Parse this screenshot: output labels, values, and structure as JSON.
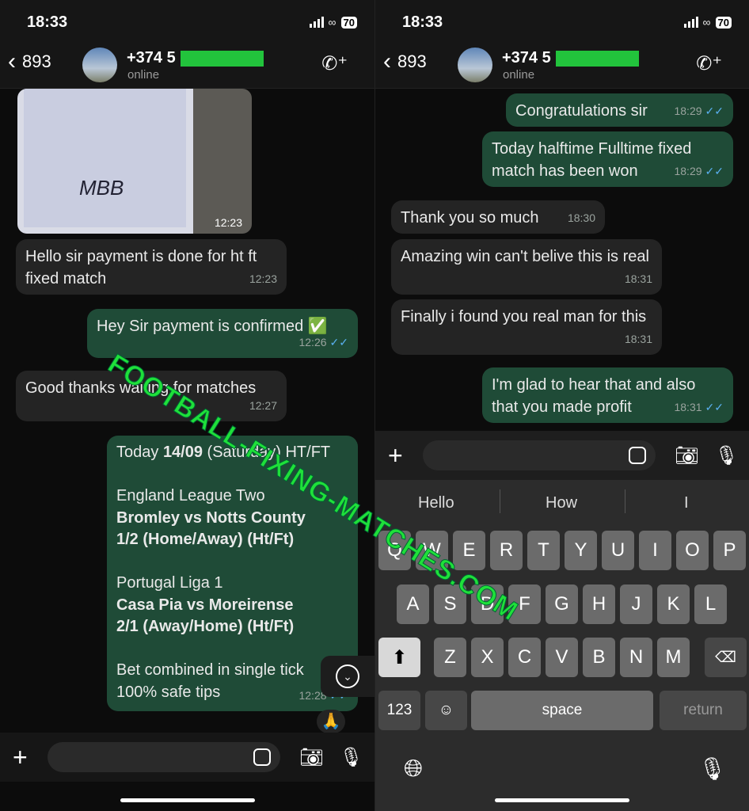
{
  "status": {
    "time": "18:33",
    "battery": "70"
  },
  "header": {
    "back_count": "893",
    "contact": "+374 5",
    "presence": "online"
  },
  "left_messages": [
    {
      "type": "image",
      "time": "12:23",
      "sig": "MBB"
    },
    {
      "dir": "in",
      "text": "Hello sir payment is done for ht ft fixed match",
      "time": "12:23"
    },
    {
      "dir": "out",
      "text": "Hey Sir payment is confirmed ✅",
      "time": "12:26"
    },
    {
      "dir": "in",
      "text": "Good thanks waiting for matches",
      "time": "12:27"
    },
    {
      "dir": "out",
      "time": "12:28",
      "reaction": "🙏",
      "lines": {
        "l1a": "Today ",
        "l1b": "14/09",
        "l1c": " (Saturday) HT/FT",
        "l2": "England League Two",
        "l3": "Bromley vs Notts County",
        "l4": "1/2 (Home/Away) (Ht/Ft)",
        "l5": "Portugal Liga 1",
        "l6": "Casa Pia vs Moreirense",
        "l7": "2/1 (Away/Home) (Ht/Ft)",
        "l8": "Bet combined in single tick",
        "l9": "100% safe tips"
      }
    }
  ],
  "right_messages": [
    {
      "dir": "out",
      "text": "Congratulations sir",
      "time": "18:29"
    },
    {
      "dir": "out",
      "text": "Today halftime Fulltime fixed match has been won",
      "time": "18:29"
    },
    {
      "dir": "in",
      "text": "Thank you so much",
      "time": "18:30"
    },
    {
      "dir": "in",
      "text": "Amazing win can't belive this is real",
      "time": "18:31"
    },
    {
      "dir": "in",
      "text": "Finally i found you real man for this",
      "time": "18:31"
    },
    {
      "dir": "out",
      "text": "I'm glad to hear that and also that you made profit",
      "time": "18:31"
    }
  ],
  "keyboard": {
    "suggestions": [
      "Hello",
      "How",
      "I"
    ],
    "row1": [
      "Q",
      "W",
      "E",
      "R",
      "T",
      "Y",
      "U",
      "I",
      "O",
      "P"
    ],
    "row2": [
      "A",
      "S",
      "D",
      "F",
      "G",
      "H",
      "J",
      "K",
      "L"
    ],
    "row3": [
      "Z",
      "X",
      "C",
      "V",
      "B",
      "N",
      "M"
    ],
    "num": "123",
    "space": "space",
    "return": "return"
  },
  "watermark": "FOOTBALL-FIXING-MATCHES.COM",
  "colors": {
    "outgoing": "#1f4b37",
    "incoming": "#242424",
    "read_tick": "#5ab0f0",
    "watermark": "#1fe03a"
  }
}
